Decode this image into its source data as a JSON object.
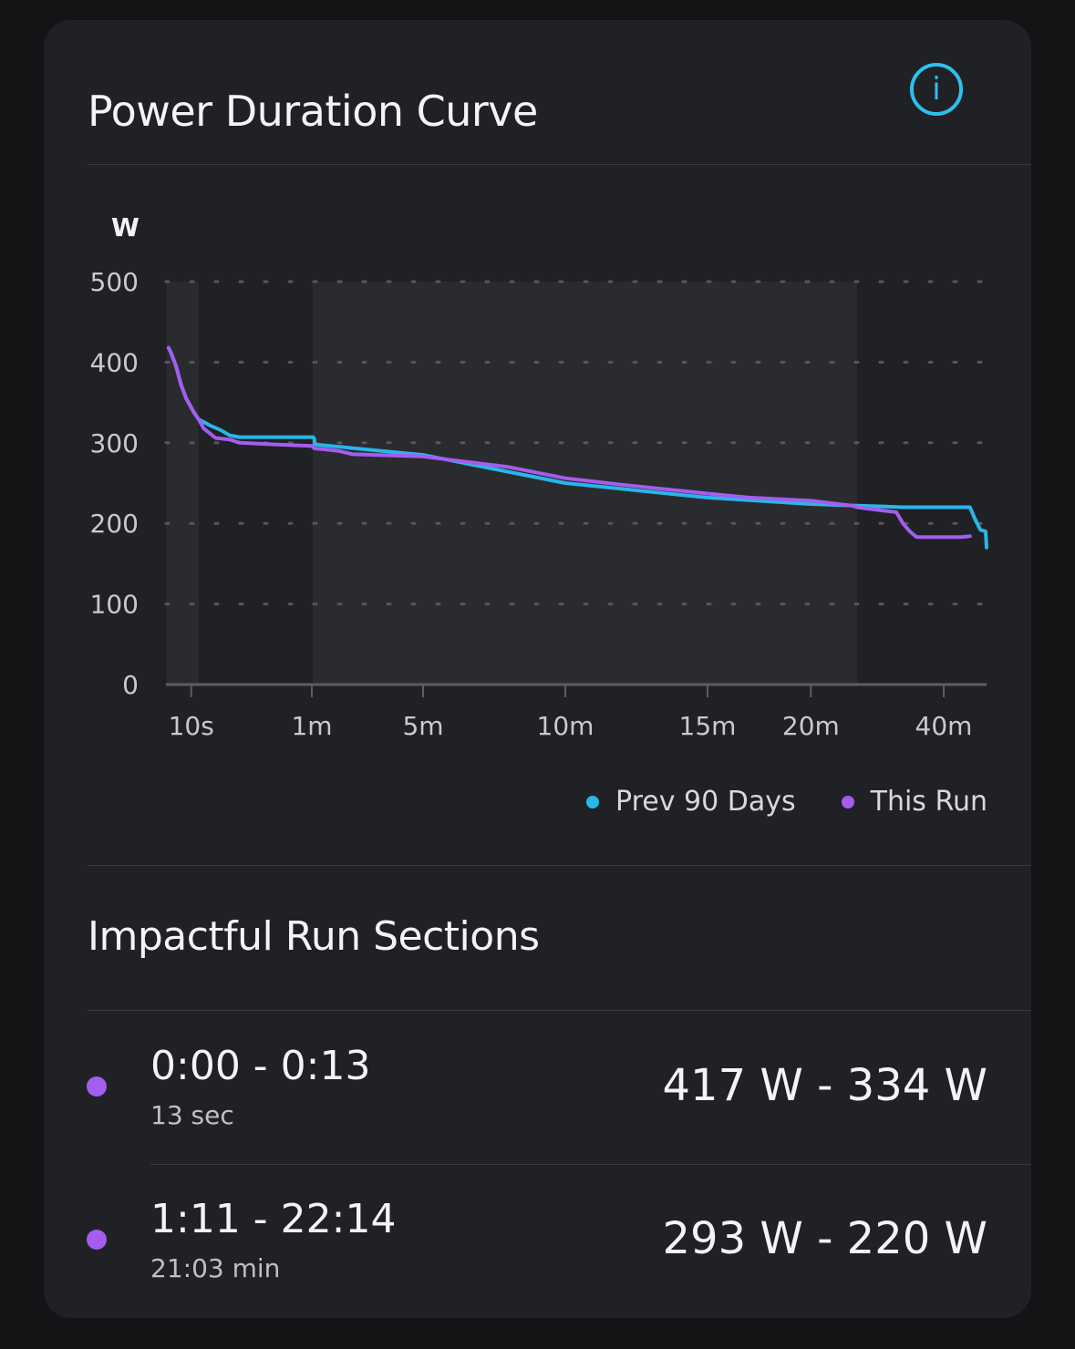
{
  "card": {
    "title": "Power Duration Curve",
    "info_glyph": "i"
  },
  "colors": {
    "background": "#131416",
    "card": "#202124",
    "prev_90_days": "#29b6e8",
    "this_run": "#a45df0"
  },
  "chart_data": {
    "type": "line",
    "ylabel": "W",
    "ylim": [
      0,
      500
    ],
    "y_ticks": [
      0,
      100,
      200,
      300,
      400,
      500
    ],
    "x_tick_labels": [
      "10s",
      "1m",
      "5m",
      "10m",
      "15m",
      "20m",
      "40m"
    ],
    "x_unit": "seconds",
    "x_scale": "nonlinear (ticks unevenly spaced)",
    "grid": "dotted horizontal lines",
    "legend_position": "bottom-right",
    "highlighted_ranges": [
      {
        "from": 1,
        "to": 13
      },
      {
        "from": 71,
        "to": 1334
      }
    ],
    "series": [
      {
        "name": "Prev 90 Days",
        "color": "#29b6e8",
        "points": [
          [
            1,
            418
          ],
          [
            2,
            412
          ],
          [
            4,
            395
          ],
          [
            6,
            372
          ],
          [
            8,
            355
          ],
          [
            11,
            338
          ],
          [
            13,
            329
          ],
          [
            18,
            321
          ],
          [
            22,
            316
          ],
          [
            26,
            309
          ],
          [
            30,
            307
          ],
          [
            40,
            307
          ],
          [
            55,
            307
          ],
          [
            65,
            307
          ],
          [
            70,
            305
          ],
          [
            71,
            298
          ],
          [
            300,
            285
          ],
          [
            600,
            250
          ],
          [
            900,
            232
          ],
          [
            1200,
            224
          ],
          [
            1334,
            222
          ],
          [
            1500,
            221
          ],
          [
            1800,
            220
          ],
          [
            2400,
            220
          ],
          [
            2700,
            220
          ],
          [
            2760,
            205
          ],
          [
            2820,
            192
          ],
          [
            2880,
            190
          ],
          [
            2890,
            170
          ]
        ]
      },
      {
        "name": "This Run",
        "color": "#a45df0",
        "points": [
          [
            1,
            418
          ],
          [
            2,
            412
          ],
          [
            4,
            395
          ],
          [
            6,
            372
          ],
          [
            8,
            355
          ],
          [
            11,
            338
          ],
          [
            13,
            329
          ],
          [
            15,
            318
          ],
          [
            20,
            306
          ],
          [
            26,
            304
          ],
          [
            30,
            300
          ],
          [
            45,
            298
          ],
          [
            60,
            296
          ],
          [
            71,
            293
          ],
          [
            90,
            292
          ],
          [
            120,
            290
          ],
          [
            150,
            286
          ],
          [
            200,
            285
          ],
          [
            300,
            283
          ],
          [
            480,
            270
          ],
          [
            600,
            256
          ],
          [
            720,
            248
          ],
          [
            900,
            237
          ],
          [
            1020,
            232
          ],
          [
            1200,
            228
          ],
          [
            1320,
            222
          ],
          [
            1334,
            220
          ],
          [
            1500,
            216
          ],
          [
            1700,
            214
          ],
          [
            1800,
            200
          ],
          [
            1900,
            190
          ],
          [
            2000,
            183
          ],
          [
            2200,
            183
          ],
          [
            2400,
            183
          ],
          [
            2600,
            183
          ],
          [
            2700,
            184
          ]
        ]
      }
    ]
  },
  "legend": [
    {
      "label": "Prev 90 Days",
      "color": "#29b6e8"
    },
    {
      "label": "This Run",
      "color": "#a45df0"
    }
  ],
  "sections": {
    "title": "Impactful Run Sections",
    "rows": [
      {
        "range": "0:00  - 0:13",
        "duration": "13 sec",
        "watts": "417 W - 334 W"
      },
      {
        "range": "1:11  - 22:14",
        "duration": "21:03 min",
        "watts": "293 W - 220 W"
      }
    ]
  }
}
